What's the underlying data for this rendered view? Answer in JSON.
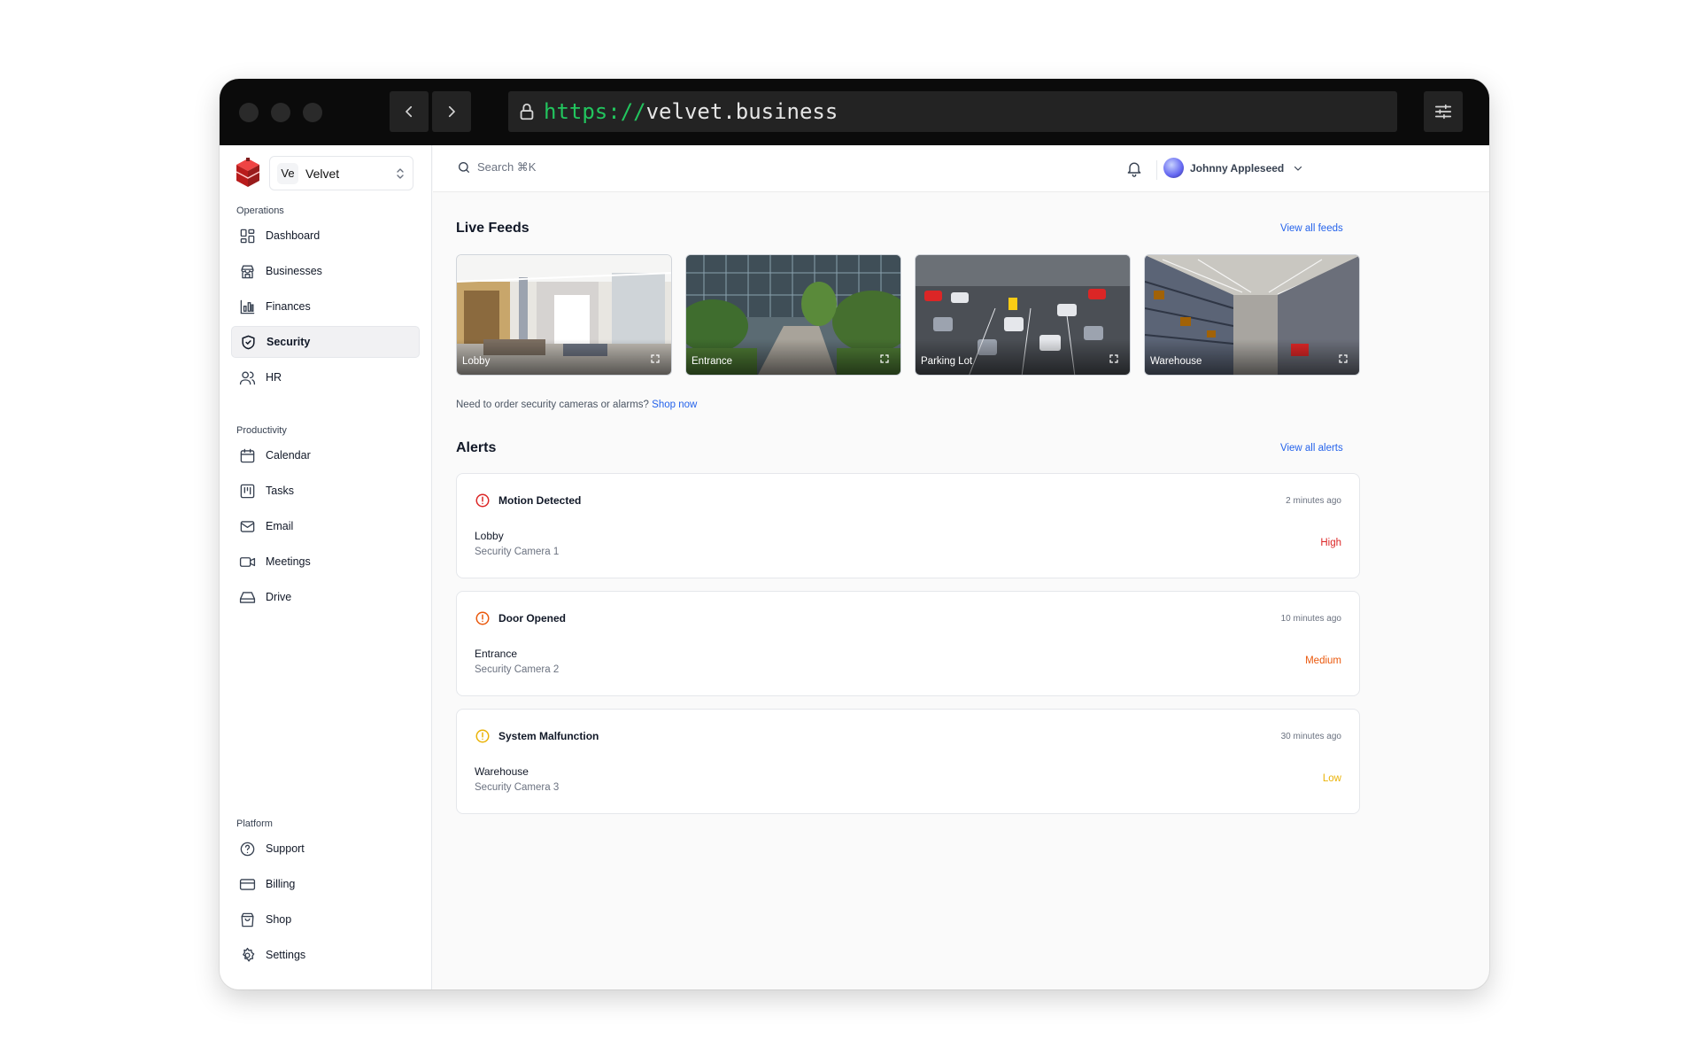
{
  "browser": {
    "url_scheme": "https://",
    "url_host": "velvet.business"
  },
  "org": {
    "badge": "Ve",
    "name": "Velvet"
  },
  "sidebar": {
    "sections": [
      {
        "label": "Operations",
        "items": [
          {
            "label": "Dashboard",
            "icon": "dashboard-icon"
          },
          {
            "label": "Businesses",
            "icon": "store-icon"
          },
          {
            "label": "Finances",
            "icon": "bar-chart-icon"
          },
          {
            "label": "Security",
            "icon": "shield-icon",
            "active": true
          },
          {
            "label": "HR",
            "icon": "users-icon"
          }
        ]
      },
      {
        "label": "Productivity",
        "items": [
          {
            "label": "Calendar",
            "icon": "calendar-icon"
          },
          {
            "label": "Tasks",
            "icon": "kanban-icon"
          },
          {
            "label": "Email",
            "icon": "mail-icon"
          },
          {
            "label": "Meetings",
            "icon": "video-icon"
          },
          {
            "label": "Drive",
            "icon": "drive-icon"
          }
        ]
      },
      {
        "label": "Platform",
        "items": [
          {
            "label": "Support",
            "icon": "help-circle-icon"
          },
          {
            "label": "Billing",
            "icon": "credit-card-icon"
          },
          {
            "label": "Shop",
            "icon": "shopping-bag-icon"
          },
          {
            "label": "Settings",
            "icon": "gear-icon"
          }
        ]
      }
    ]
  },
  "topbar": {
    "search_placeholder": "Search ⌘K",
    "user_name": "Johnny Appleseed"
  },
  "feeds": {
    "title": "Live Feeds",
    "view_all": "View all feeds",
    "items": [
      {
        "label": "Lobby"
      },
      {
        "label": "Entrance"
      },
      {
        "label": "Parking Lot"
      },
      {
        "label": "Warehouse"
      }
    ],
    "order_prompt": "Need to order security cameras or alarms?",
    "order_link": "Shop now"
  },
  "alerts": {
    "title": "Alerts",
    "view_all": "View all alerts",
    "items": [
      {
        "title": "Motion Detected",
        "time": "2 minutes ago",
        "location": "Lobby",
        "camera": "Security Camera 1",
        "severity": "High",
        "color": "#dc2626"
      },
      {
        "title": "Door Opened",
        "time": "10 minutes ago",
        "location": "Entrance",
        "camera": "Security Camera 2",
        "severity": "Medium",
        "color": "#ea580c"
      },
      {
        "title": "System Malfunction",
        "time": "30 minutes ago",
        "location": "Warehouse",
        "camera": "Security Camera 3",
        "severity": "Low",
        "color": "#eab308"
      }
    ]
  },
  "colors": {
    "accent": "#2563eb",
    "brand": "#dc2626",
    "chrome": "#0b0b0b"
  }
}
